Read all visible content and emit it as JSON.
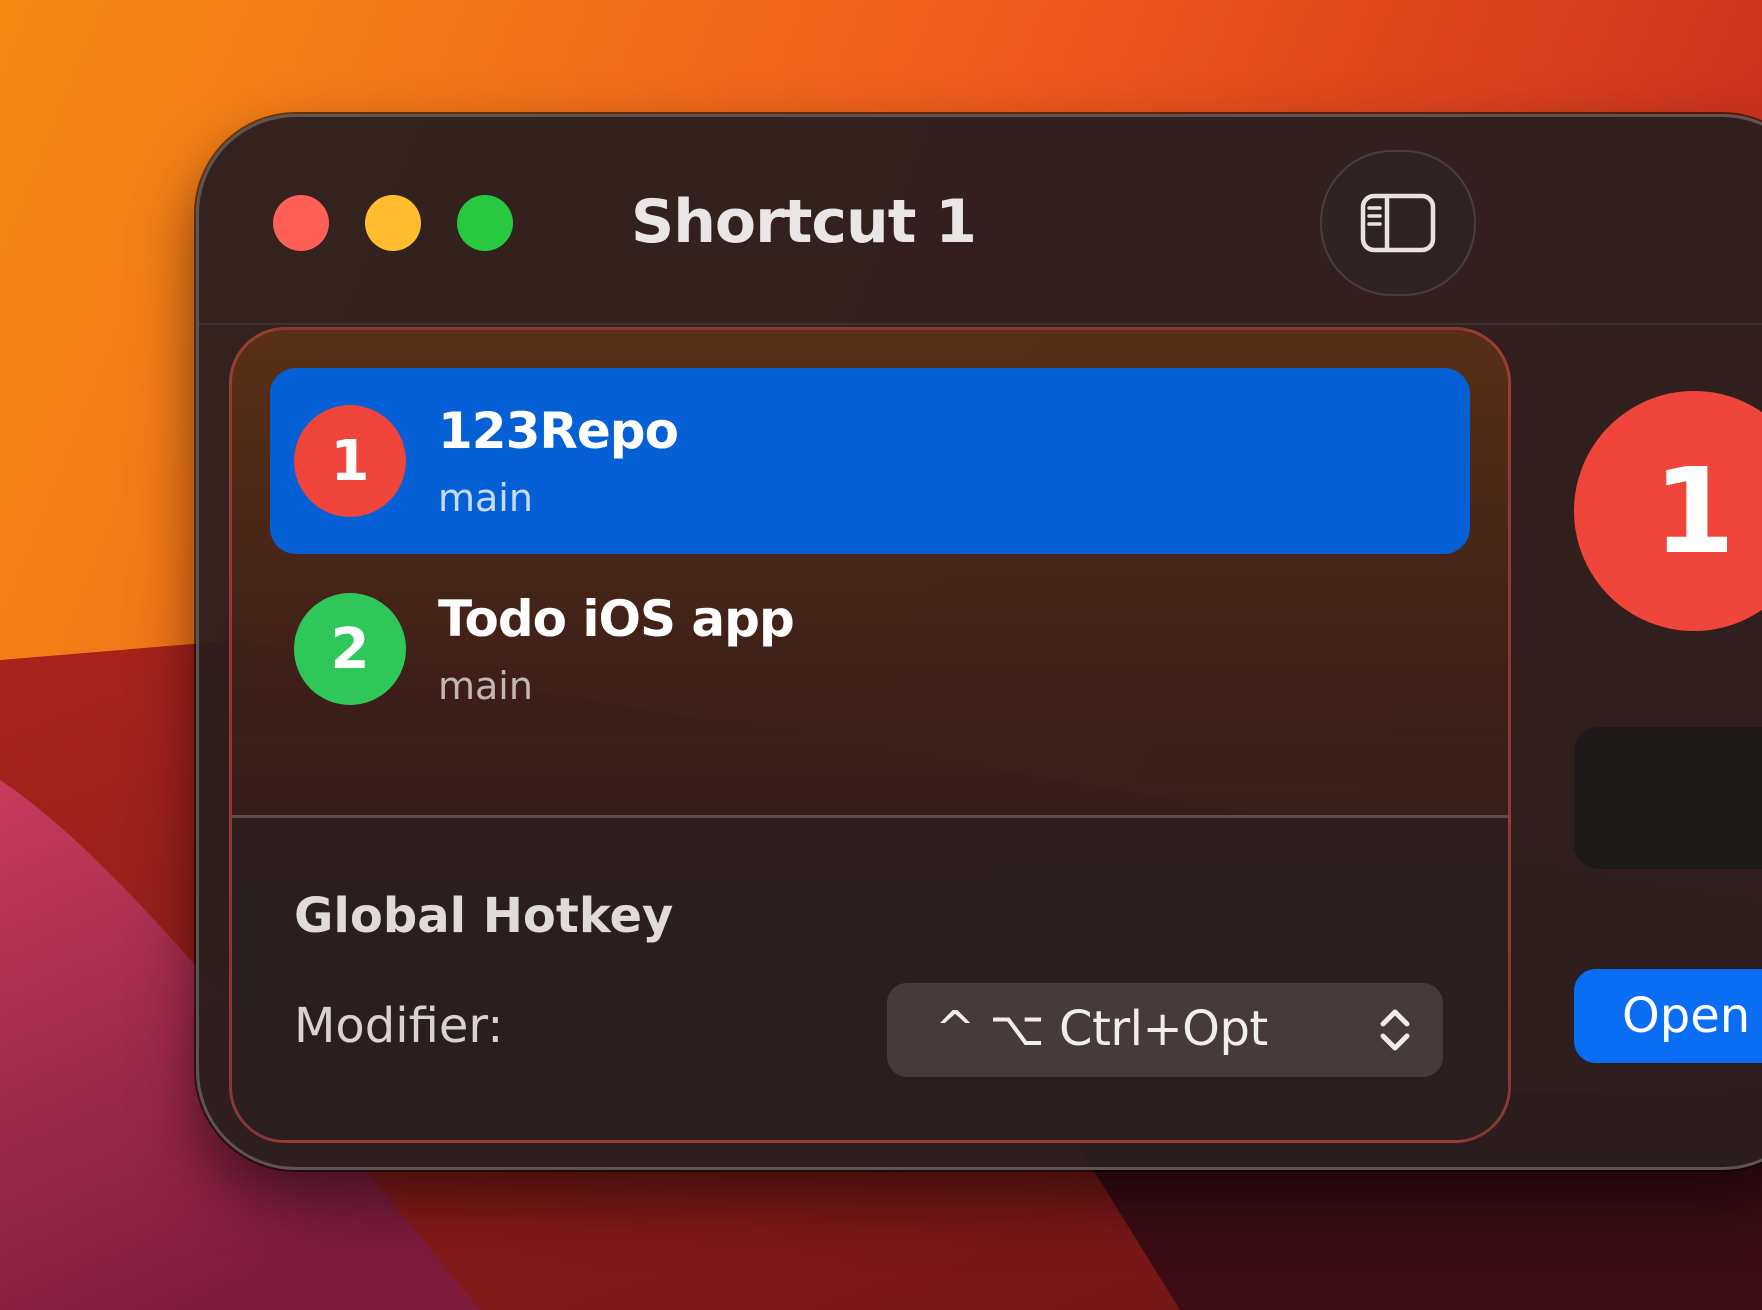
{
  "window": {
    "title": "Shortcut 1",
    "traffic_lights": [
      {
        "name": "close",
        "color": "#fe5f57"
      },
      {
        "name": "minimize",
        "color": "#febc2e"
      },
      {
        "name": "zoom",
        "color": "#28c840"
      }
    ],
    "sidebar_toggle_icon": "sidebar-left-icon"
  },
  "repos": [
    {
      "number": "1",
      "name": "123Repo",
      "branch": "main",
      "color": "#f0453a",
      "selected": true
    },
    {
      "number": "2",
      "name": "Todo iOS app",
      "branch": "main",
      "color": "#30c75a",
      "selected": false
    }
  ],
  "hotkey": {
    "section_title": "Global Hotkey",
    "modifier_label": "Modifier:",
    "modifier_value": "^ ⌥ Ctrl+Opt",
    "chevron_icon": "chevron-up-down-icon"
  },
  "detail": {
    "badge_number": "1",
    "badge_color": "#f0453a",
    "open_button_label": "Open"
  },
  "colors": {
    "selection": "#0560d6",
    "accent_button": "#0a6ef5"
  }
}
